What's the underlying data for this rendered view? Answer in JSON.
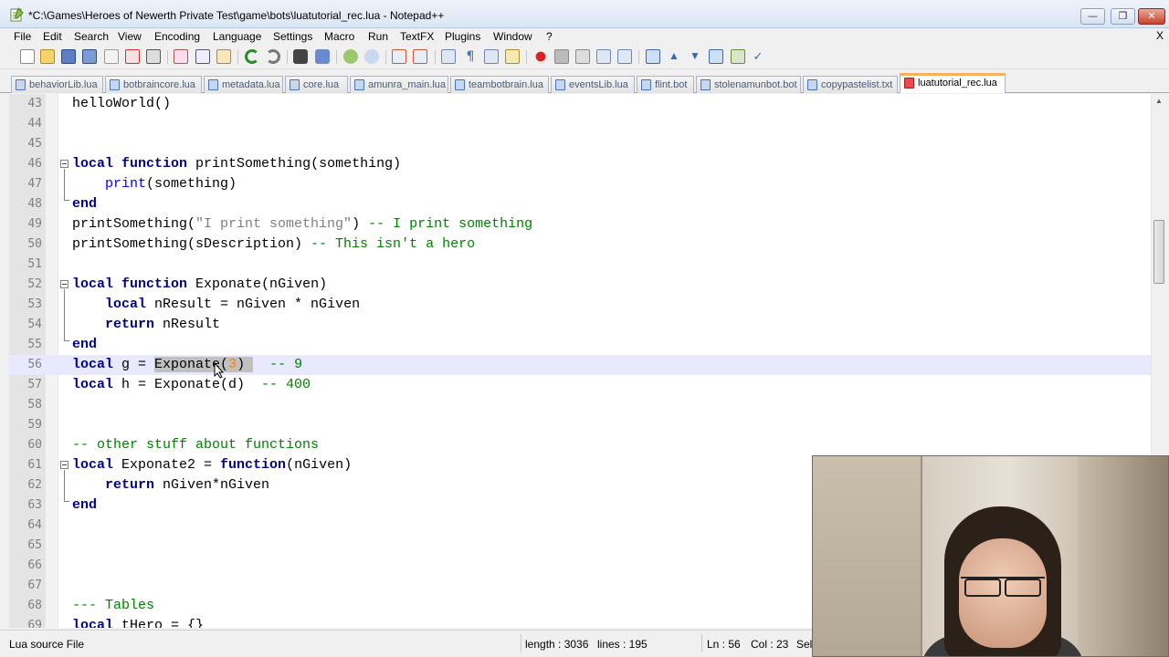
{
  "window": {
    "title": "*C:\\Games\\Heroes of Newerth Private Test\\game\\bots\\luatutorial_rec.lua - Notepad++",
    "minimize_label": "—",
    "maximize_label": "❐",
    "close_label": "✕"
  },
  "menu": {
    "items": [
      "File",
      "Edit",
      "Search",
      "View",
      "Encoding",
      "Language",
      "Settings",
      "Macro",
      "Run",
      "TextFX",
      "Plugins",
      "Window",
      "?"
    ],
    "close_doc": "X"
  },
  "toolbar": {
    "icons": [
      "new-file-icon",
      "open-file-icon",
      "save-icon",
      "save-all-icon",
      "close-icon",
      "close-all-icon",
      "print-icon",
      "cut-icon",
      "copy-icon",
      "paste-icon",
      "undo-icon",
      "redo-icon",
      "find-icon",
      "replace-icon",
      "zoom-in-icon",
      "zoom-out-icon",
      "sync-vertical-icon",
      "sync-horizontal-icon",
      "word-wrap-icon",
      "show-all-chars-icon",
      "indent-guide-icon",
      "user-lang-icon",
      "record-macro-icon",
      "stop-macro-icon",
      "play-macro-icon",
      "run-macro-multiple-icon",
      "save-macro-icon",
      "fold-all-icon",
      "prev-icon",
      "next-icon",
      "trim-icon",
      "spellcheck-icon",
      "settings-icon"
    ]
  },
  "tabs": [
    {
      "label": "behaviorLib.lua",
      "active": false
    },
    {
      "label": "botbraincore.lua",
      "active": false
    },
    {
      "label": "metadata.lua",
      "active": false
    },
    {
      "label": "core.lua",
      "active": false
    },
    {
      "label": "amunra_main.lua",
      "active": false
    },
    {
      "label": "teambotbrain.lua",
      "active": false
    },
    {
      "label": "eventsLib.lua",
      "active": false
    },
    {
      "label": "flint.bot",
      "active": false
    },
    {
      "label": "stolenamunbot.bot",
      "active": false
    },
    {
      "label": "copypastelist.txt",
      "active": false
    },
    {
      "label": "luatutorial_rec.lua",
      "active": true
    }
  ],
  "editor": {
    "current_line": 56,
    "lines": [
      {
        "n": "43",
        "tokens": [
          {
            "t": "helloWorld()",
            "c": ""
          }
        ]
      },
      {
        "n": "44",
        "tokens": []
      },
      {
        "n": "45",
        "tokens": []
      },
      {
        "n": "46",
        "tokens": [
          {
            "t": "local",
            "c": "kw"
          },
          {
            "t": " ",
            "c": ""
          },
          {
            "t": "function",
            "c": "kw"
          },
          {
            "t": " printSomething(something)",
            "c": ""
          }
        ]
      },
      {
        "n": "47",
        "tokens": [
          {
            "t": "    ",
            "c": ""
          },
          {
            "t": "print",
            "c": "fn"
          },
          {
            "t": "(something)",
            "c": ""
          }
        ]
      },
      {
        "n": "48",
        "tokens": [
          {
            "t": "end",
            "c": "kw"
          }
        ]
      },
      {
        "n": "49",
        "tokens": [
          {
            "t": "printSomething(",
            "c": ""
          },
          {
            "t": "\"I print something\"",
            "c": "str"
          },
          {
            "t": ") ",
            "c": ""
          },
          {
            "t": "-- I print something",
            "c": "cm"
          }
        ]
      },
      {
        "n": "50",
        "tokens": [
          {
            "t": "printSomething(sDescription) ",
            "c": ""
          },
          {
            "t": "-- This isn't a hero",
            "c": "cm"
          }
        ]
      },
      {
        "n": "51",
        "tokens": []
      },
      {
        "n": "52",
        "tokens": [
          {
            "t": "local",
            "c": "kw"
          },
          {
            "t": " ",
            "c": ""
          },
          {
            "t": "function",
            "c": "kw"
          },
          {
            "t": " Exponate(nGiven)",
            "c": ""
          }
        ]
      },
      {
        "n": "53",
        "tokens": [
          {
            "t": "    ",
            "c": ""
          },
          {
            "t": "local",
            "c": "kw"
          },
          {
            "t": " nResult = nGiven * nGiven",
            "c": ""
          }
        ]
      },
      {
        "n": "54",
        "tokens": [
          {
            "t": "    ",
            "c": ""
          },
          {
            "t": "return",
            "c": "kw"
          },
          {
            "t": " nResult",
            "c": ""
          }
        ]
      },
      {
        "n": "55",
        "tokens": [
          {
            "t": "end",
            "c": "kw"
          }
        ]
      },
      {
        "n": "56",
        "tokens": [
          {
            "t": "local",
            "c": "kw"
          },
          {
            "t": " g = ",
            "c": ""
          },
          {
            "t": "Exponate(",
            "c": "sel"
          },
          {
            "t": "3",
            "c": "sel num"
          },
          {
            "t": ") ",
            "c": "sel"
          },
          {
            "t": "  ",
            "c": ""
          },
          {
            "t": "-- 9",
            "c": "cm"
          }
        ]
      },
      {
        "n": "57",
        "tokens": [
          {
            "t": "local",
            "c": "kw"
          },
          {
            "t": " h = Exponate(d)  ",
            "c": ""
          },
          {
            "t": "-- 400",
            "c": "cm"
          }
        ]
      },
      {
        "n": "58",
        "tokens": []
      },
      {
        "n": "59",
        "tokens": []
      },
      {
        "n": "60",
        "tokens": [
          {
            "t": "-- other stuff about functions",
            "c": "cm"
          }
        ]
      },
      {
        "n": "61",
        "tokens": [
          {
            "t": "local",
            "c": "kw"
          },
          {
            "t": " Exponate2 = ",
            "c": ""
          },
          {
            "t": "function",
            "c": "kw"
          },
          {
            "t": "(nGiven)",
            "c": ""
          }
        ]
      },
      {
        "n": "62",
        "tokens": [
          {
            "t": "    ",
            "c": ""
          },
          {
            "t": "return",
            "c": "kw"
          },
          {
            "t": " nGiven*nGiven",
            "c": ""
          }
        ]
      },
      {
        "n": "63",
        "tokens": [
          {
            "t": "end",
            "c": "kw"
          }
        ]
      },
      {
        "n": "64",
        "tokens": []
      },
      {
        "n": "65",
        "tokens": []
      },
      {
        "n": "66",
        "tokens": []
      },
      {
        "n": "67",
        "tokens": []
      },
      {
        "n": "68",
        "tokens": [
          {
            "t": "--- Tables",
            "c": "cm"
          }
        ]
      },
      {
        "n": "69",
        "tokens": [
          {
            "t": "local",
            "c": "kw"
          },
          {
            "t": " tHero = {}",
            "c": ""
          }
        ]
      }
    ]
  },
  "status": {
    "file_type": "Lua source File",
    "length": "length : 3036",
    "lines": "lines : 195",
    "ln": "Ln : 56",
    "col": "Col : 23",
    "sel": "Sel"
  },
  "colors": {
    "keyword": "#00008b",
    "builtin": "#0000ff",
    "string": "#808080",
    "comment": "#008000",
    "number": "#ff8000",
    "current_line": "#e8e8ff",
    "active_tab_accent": "#fab05a"
  }
}
